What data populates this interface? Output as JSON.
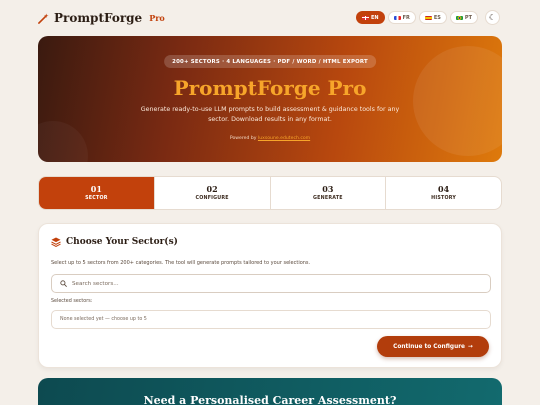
{
  "brand": {
    "name": "PromptForge",
    "badge": "Pro",
    "icon": "wand-icon"
  },
  "languages": [
    {
      "code": "EN",
      "active": true,
      "flag": "uk-flag"
    },
    {
      "code": "FR",
      "active": false,
      "flag": "france-flag"
    },
    {
      "code": "ES",
      "active": false,
      "flag": "spain-flag"
    },
    {
      "code": "PT",
      "active": false,
      "flag": "brazil-flag"
    }
  ],
  "theme_toggle": {
    "icon": "moon-icon"
  },
  "hero": {
    "badge": "200+ SECTORS · 4 LANGUAGES · PDF / WORD / HTML EXPORT",
    "title": "PromptForge Pro",
    "description": "Generate ready-to-use LLM prompts to build assessment & guidance tools for any sector. Download results in any format.",
    "powered_prefix": "Powered by",
    "powered_link": "luxsoune.edutech.com"
  },
  "steps": [
    {
      "num": "01",
      "label": "SECTOR",
      "active": true
    },
    {
      "num": "02",
      "label": "CONFIGURE",
      "active": false
    },
    {
      "num": "03",
      "label": "GENERATE",
      "active": false
    },
    {
      "num": "04",
      "label": "HISTORY",
      "active": false
    }
  ],
  "sector_card": {
    "title": "Choose Your Sector(s)",
    "description": "Select up to 5 sectors from 200+ categories. The tool will generate prompts tailored to your selections.",
    "search_placeholder": "Search sectors...",
    "selected_label": "Selected sectors:",
    "selected_empty": "None selected yet — choose up to 5",
    "continue_label": "Continue to Configure",
    "continue_arrow": "→"
  },
  "career_banner": {
    "title": "Need a Personalised Career Assessment?"
  },
  "colors": {
    "accent": "#c2410c",
    "hero_title": "#f7a52a",
    "teal": "#126a6e",
    "background": "#f4efe9"
  }
}
